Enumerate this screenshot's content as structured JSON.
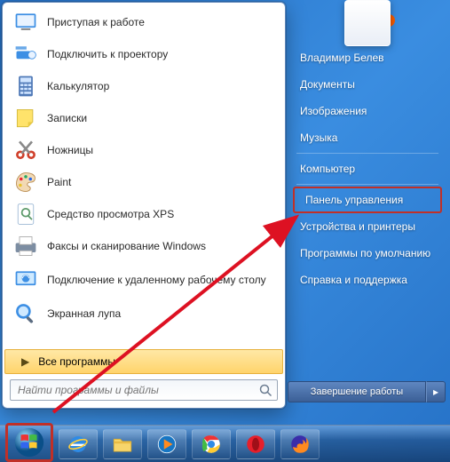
{
  "start_menu": {
    "items": [
      {
        "label": "Приступая к работе",
        "icon": "getting-started"
      },
      {
        "label": "Подключить к проектору",
        "icon": "projector"
      },
      {
        "label": "Калькулятор",
        "icon": "calculator"
      },
      {
        "label": "Записки",
        "icon": "sticky-notes"
      },
      {
        "label": "Ножницы",
        "icon": "snipping"
      },
      {
        "label": "Paint",
        "icon": "paint"
      },
      {
        "label": "Средство просмотра XPS",
        "icon": "xps"
      },
      {
        "label": "Факсы и сканирование Windows",
        "icon": "fax"
      },
      {
        "label": "Подключение к удаленному рабочему столу",
        "icon": "rdp",
        "multi": true
      },
      {
        "label": "Экранная лупа",
        "icon": "magnifier"
      }
    ],
    "all_programs": "Все программы",
    "search_placeholder": "Найти программы и файлы"
  },
  "right_pane": {
    "user": "Владимир Белев",
    "links_a": [
      "Документы",
      "Изображения",
      "Музыка"
    ],
    "links_b": [
      "Компьютер"
    ],
    "highlighted": "Панель управления",
    "links_c": [
      "Устройства и принтеры",
      "Программы по умолчанию",
      "Справка и поддержка"
    ]
  },
  "shutdown": {
    "label": "Завершение работы"
  },
  "taskbar": {
    "items": [
      "ie",
      "explorer",
      "wmp",
      "chrome",
      "opera",
      "firefox"
    ]
  }
}
